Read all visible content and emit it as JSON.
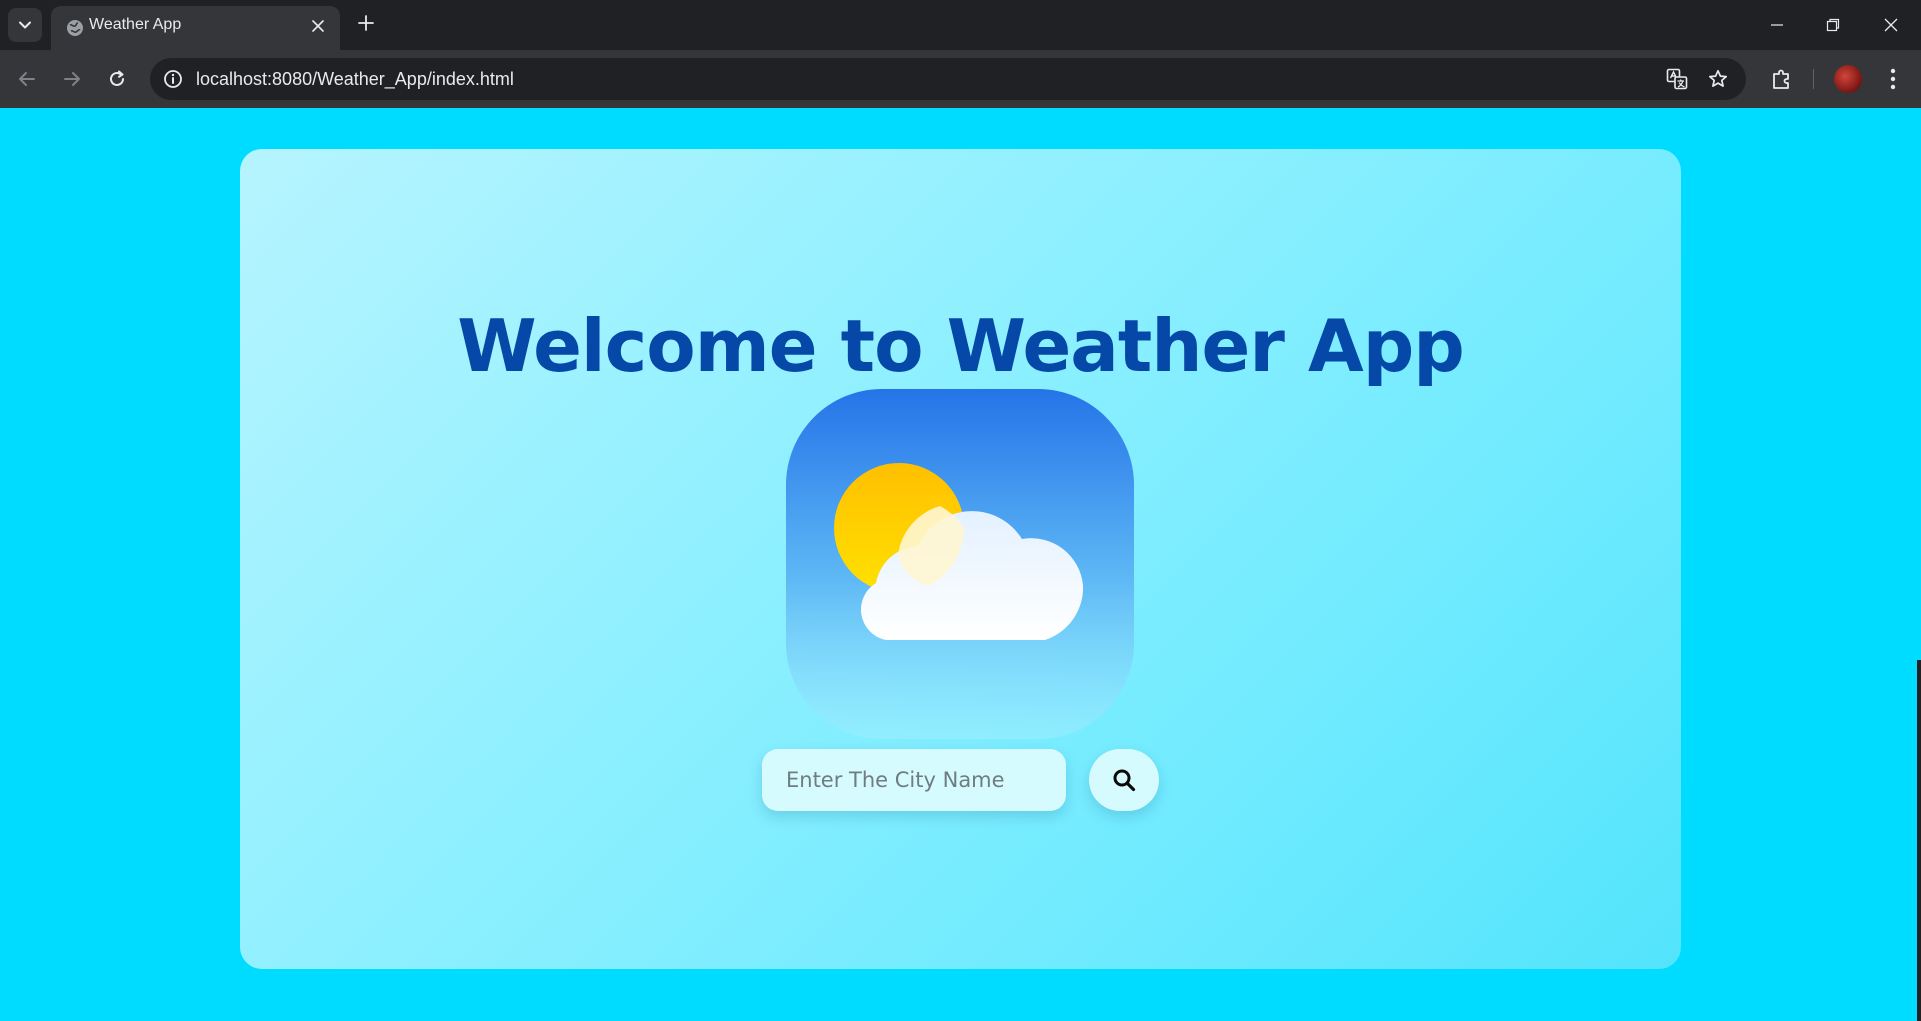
{
  "browser": {
    "tab_title": "Weather App",
    "url": "localhost:8080/Weather_App/index.html"
  },
  "page": {
    "heading": "Welcome to Weather App",
    "search": {
      "placeholder": "Enter The City Name",
      "value": ""
    }
  },
  "icons": {
    "tab_search": "chevron-down-icon",
    "tab_favicon": "globe-icon",
    "tab_close": "close-icon",
    "new_tab": "plus-icon",
    "minimize": "minimize-icon",
    "restore": "restore-icon",
    "close_window": "close-icon",
    "back": "arrow-left-icon",
    "forward": "arrow-right-icon",
    "reload": "reload-icon",
    "site_info": "info-icon",
    "translate": "translate-icon",
    "bookmark": "star-icon",
    "extensions": "puzzle-icon",
    "menu": "kebab-menu-icon",
    "search_button": "search-icon",
    "logo": "sun-cloud-icon"
  },
  "colors": {
    "page_background": "#00dcff",
    "heading": "#0548a7",
    "chrome_dark": "#202124",
    "chrome_toolbar": "#35363a"
  }
}
